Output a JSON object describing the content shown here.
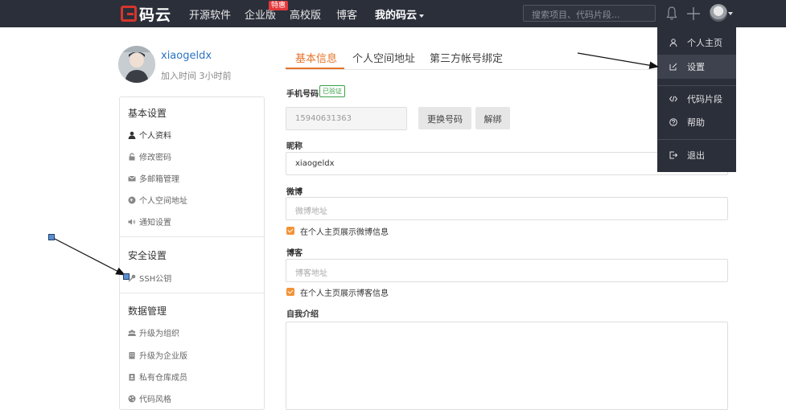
{
  "topnav": {
    "logo_text": "码云",
    "items": [
      "开源软件",
      "企业版",
      "高校版",
      "博客",
      "我的码云"
    ],
    "badge": "特惠",
    "search_placeholder": "搜索项目、代码片段...",
    "bg_color": "#2b2f3a",
    "accent_color": "#d7362c"
  },
  "profile": {
    "username": "xiaogeldx",
    "join_time": "加入时间 3小时前"
  },
  "sidebar": {
    "sections": [
      {
        "title": "基本设置",
        "items": [
          {
            "label": "个人资料",
            "icon": "user-icon"
          },
          {
            "label": "修改密码",
            "icon": "lock-icon"
          },
          {
            "label": "多邮箱管理",
            "icon": "mail-icon"
          },
          {
            "label": "个人空间地址",
            "icon": "globe-icon"
          },
          {
            "label": "通知设置",
            "icon": "speaker-icon"
          }
        ]
      },
      {
        "title": "安全设置",
        "items": [
          {
            "label": "SSH公钥",
            "icon": "key-icon"
          }
        ]
      },
      {
        "title": "数据管理",
        "items": [
          {
            "label": "升级为组织",
            "icon": "group-icon"
          },
          {
            "label": "升级为企业版",
            "icon": "building-icon"
          },
          {
            "label": "私有仓库成员",
            "icon": "member-icon"
          },
          {
            "label": "代码风格",
            "icon": "palette-icon"
          }
        ]
      }
    ]
  },
  "tabs": [
    "基本信息",
    "个人空间地址",
    "第三方帐号绑定"
  ],
  "form": {
    "phone_label": "手机号码",
    "verified_badge": "已验证",
    "phone_value": "15940631363",
    "change_button": "更换号码",
    "unbind_button": "解绑",
    "nickname_label": "昵称",
    "nickname_value": "xiaogeldx",
    "weibo_label": "微博",
    "weibo_placeholder": "微博地址",
    "weibo_show_label": "在个人主页展示微博信息",
    "blog_label": "博客",
    "blog_placeholder": "博客地址",
    "blog_show_label": "在个人主页展示博客信息",
    "bio_label": "自我介绍"
  },
  "dropdown": {
    "items": [
      {
        "label": "个人主页",
        "icon": "person-icon"
      },
      {
        "label": "设置",
        "icon": "edit-icon"
      },
      {
        "label": "代码片段",
        "icon": "code-icon"
      },
      {
        "label": "帮助",
        "icon": "help-icon"
      },
      {
        "label": "退出",
        "icon": "logout-icon"
      }
    ],
    "active": "设置"
  }
}
